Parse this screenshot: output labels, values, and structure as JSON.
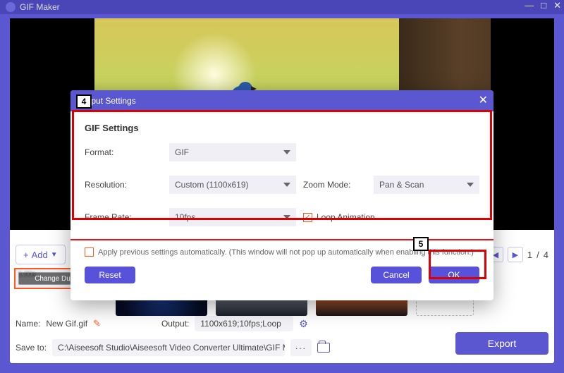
{
  "app_title": "GIF Maker",
  "titlebar": {
    "minimize": "—",
    "maximize": "□",
    "close": "✕"
  },
  "add_button": "Add",
  "pager": {
    "prev": "◀",
    "next": "▶",
    "current": "1",
    "sep": "/",
    "total": "4"
  },
  "thumbs": {
    "duration": "1.00s",
    "change_duration": "Change Duration",
    "add_plus": "+"
  },
  "footer": {
    "name_label": "Name:",
    "name_value": "New Gif.gif",
    "output_label": "Output:",
    "output_value": "1100x619;10fps;Loop",
    "saveto_label": "Save to:",
    "saveto_value": "C:\\Aiseesoft Studio\\Aiseesoft Video Converter Ultimate\\GIF Maker",
    "dots": "...",
    "export": "Export"
  },
  "modal": {
    "title": "Output Settings",
    "close": "✕",
    "section": "GIF Settings",
    "format_label": "Format:",
    "format_value": "GIF",
    "resolution_label": "Resolution:",
    "resolution_value": "Custom (1100x619)",
    "zoom_label": "Zoom Mode:",
    "zoom_value": "Pan & Scan",
    "fps_label": "Frame Rate:",
    "fps_value": "10fps",
    "loop_label": "Loop Animation",
    "loop_checked": "✓",
    "apply_label": "Apply previous settings automatically. (This window will not pop up automatically when enabling this function.)",
    "reset": "Reset",
    "cancel": "Cancel",
    "ok": "OK"
  },
  "callouts": {
    "c4": "4",
    "c5": "5"
  }
}
